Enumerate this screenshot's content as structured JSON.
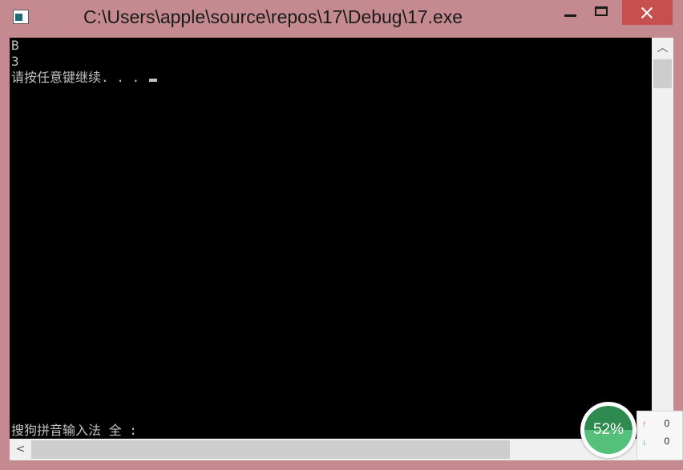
{
  "window": {
    "title": "C:\\Users\\apple\\source\\repos\\17\\Debug\\17.exe",
    "accent_close": "#c7504f",
    "frame_color": "#c48a8f"
  },
  "console": {
    "lines": [
      "B",
      "3",
      "请按任意键继续. . . "
    ],
    "ime_status": "搜狗拼音输入法 全 :"
  },
  "icons": {
    "app": "console-app-icon",
    "minimize": "minimize-icon",
    "maximize": "maximize-icon",
    "close": "close-icon",
    "scroll_up": "chevron-up-icon",
    "scroll_left": "chevron-left-icon"
  },
  "scroll_arrows": {
    "up": "︿",
    "left": "<"
  },
  "speed_widget": {
    "percent": "52%",
    "up_icon": "↑",
    "down_icon": "↓",
    "up_value": "0",
    "down_value": "0"
  }
}
